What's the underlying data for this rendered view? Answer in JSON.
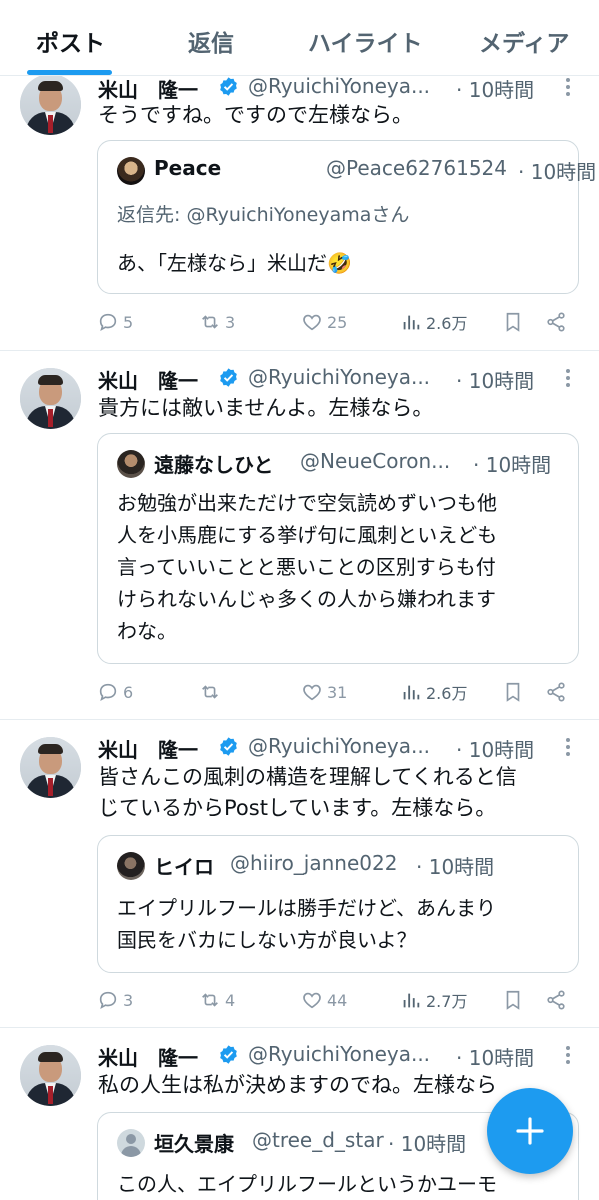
{
  "tabs": [
    {
      "label": "ポスト",
      "active": true
    },
    {
      "label": "返信",
      "active": false
    },
    {
      "label": "ハイライト",
      "active": false
    },
    {
      "label": "メディア",
      "active": false
    }
  ],
  "author": {
    "name": "米山　隆一",
    "handle": "@RyuichiYoneya...",
    "time": "· 10時間"
  },
  "tweets": [
    {
      "text_lines": [
        "そうですね。ですので左様なら。"
      ],
      "quote": {
        "name": "Peace",
        "handle": "@Peace62761524",
        "time": "· 10時間",
        "reply_to": "返信先: @RyuichiYoneyamaさん",
        "text_lines": [
          "あ、「左様なら」米山だ🤣"
        ]
      },
      "stats": {
        "replies": "5",
        "reposts": "3",
        "likes": "25",
        "views": "2.6万"
      }
    },
    {
      "text_lines": [
        "貴方には敵いませんよ。左様なら。"
      ],
      "quote": {
        "name": "遠藤なしひと",
        "handle": "@NeueCoron...",
        "time": "· 10時間",
        "text_lines": [
          "お勉強が出来ただけで空気読めずいつも他",
          "人を小馬鹿にする挙げ句に風刺といえども",
          "言っていいことと悪いことの区別すらも付",
          "けられないんじゃ多くの人から嫌われます",
          "わな。"
        ]
      },
      "stats": {
        "replies": "6",
        "reposts": "",
        "likes": "31",
        "views": "2.6万"
      }
    },
    {
      "text_lines": [
        "皆さんこの風刺の構造を理解してくれると信",
        "じているからPostしています。左様なら。"
      ],
      "quote": {
        "name": "ヒイロ",
        "handle": "@hiiro_janne022",
        "time": "· 10時間",
        "text_lines": [
          "エイプリルフールは勝手だけど、あんまり",
          "国民をバカにしない方が良いよ？"
        ]
      },
      "stats": {
        "replies": "3",
        "reposts": "4",
        "likes": "44",
        "views": "2.7万"
      }
    },
    {
      "text_lines": [
        "私の人生は私が決めますのでね。左様なら"
      ],
      "quote": {
        "name": "垣久景康",
        "handle": "@tree_d_star",
        "time": "· 10時間",
        "text_lines": [
          "この人、エイプリルフールというかユーモ"
        ]
      }
    }
  ],
  "colors": {
    "accent": "#1d9bf0",
    "text": "#0f1419",
    "secondary": "#536471",
    "border": "#cfd9de"
  },
  "icons": {
    "reply": "reply-icon",
    "repost": "repost-icon",
    "like": "like-icon",
    "views": "views-icon",
    "bookmark": "bookmark-icon",
    "share": "share-icon",
    "compose": "compose-plus-icon",
    "verified": "verified-badge-icon",
    "more": "more-icon"
  }
}
